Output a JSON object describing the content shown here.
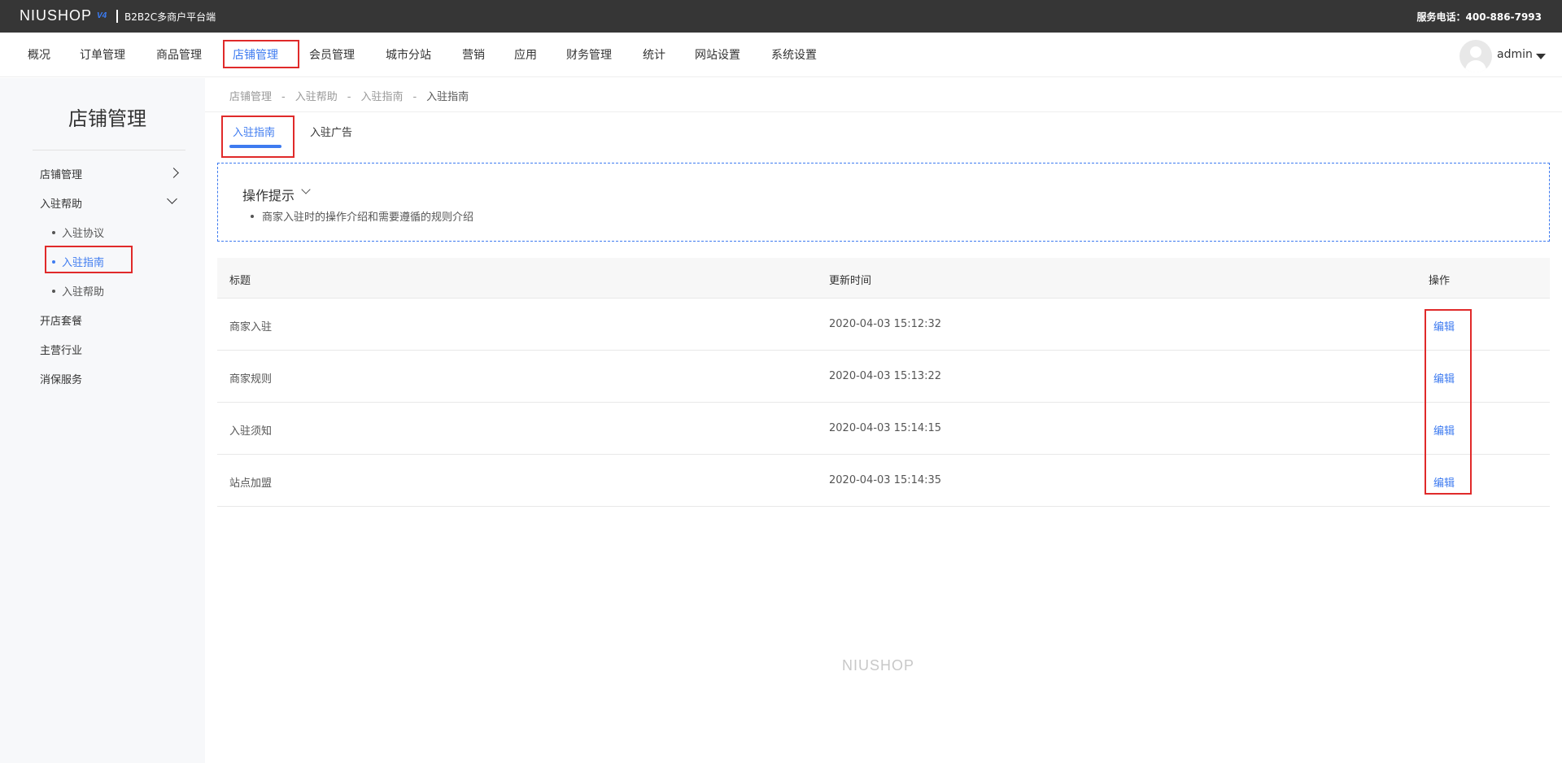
{
  "topbar": {
    "logo": "NIUSHOP",
    "logo_version": "V4",
    "subtitle": "B2B2C多商户平台端",
    "service_phone": "服务电话：400-886-7993"
  },
  "nav": {
    "items": [
      "概况",
      "订单管理",
      "商品管理",
      "店铺管理",
      "会员管理",
      "城市分站",
      "营销",
      "应用",
      "财务管理",
      "统计",
      "网站设置",
      "系统设置"
    ],
    "active": "店铺管理",
    "user": "admin"
  },
  "sidebar": {
    "title": "店铺管理",
    "items": {
      "store_manage": "店铺管理",
      "join_help": "入驻帮助",
      "join_agreement": "入驻协议",
      "join_guide": "入驻指南",
      "join_help_sub": "入驻帮助",
      "packages": "开店套餐",
      "industry": "主营行业",
      "guarantee": "消保服务"
    }
  },
  "breadcrumb": [
    "店铺管理",
    "-",
    "入驻帮助",
    "-",
    "入驻指南",
    "-",
    "入驻指南"
  ],
  "tabs": [
    "入驻指南",
    "入驻广告"
  ],
  "tips": {
    "title": "操作提示",
    "items": [
      "商家入驻时的操作介绍和需要遵循的规则介绍"
    ]
  },
  "table": {
    "headers": [
      "标题",
      "更新时间",
      "操作"
    ],
    "rows": [
      {
        "title": "商家入驻",
        "time": "2020-04-03 15:12:32",
        "action": "编辑"
      },
      {
        "title": "商家规则",
        "time": "2020-04-03 15:13:22",
        "action": "编辑"
      },
      {
        "title": "入驻须知",
        "time": "2020-04-03 15:14:15",
        "action": "编辑"
      },
      {
        "title": "站点加盟",
        "time": "2020-04-03 15:14:35",
        "action": "编辑"
      }
    ]
  },
  "footer": {
    "logo": "NIUSHOP"
  },
  "colors": {
    "accent": "#3e7bf0",
    "highlight": "#e02a2a",
    "topbar": "#363636"
  }
}
